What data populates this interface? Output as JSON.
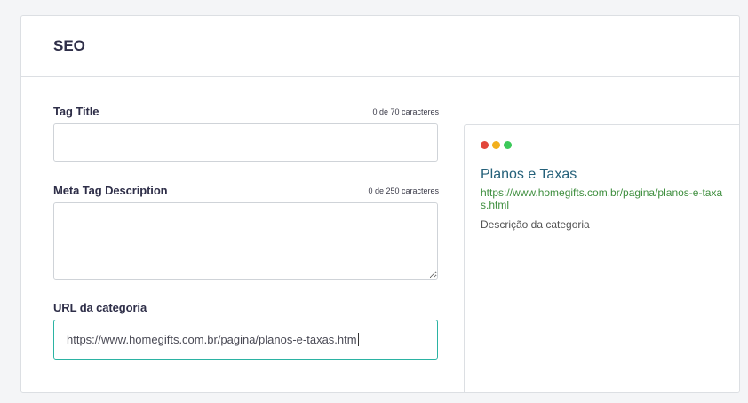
{
  "section": {
    "title": "SEO"
  },
  "fields": {
    "tag_title": {
      "label": "Tag Title",
      "counter": "0 de 70 caracteres",
      "value": ""
    },
    "meta_description": {
      "label": "Meta Tag Description",
      "counter": "0 de 250 caracteres",
      "value": ""
    },
    "category_url": {
      "label": "URL da categoria",
      "value": "https://www.homegifts.com.br/pagina/planos-e-taxas.htm"
    }
  },
  "preview": {
    "window_dots": [
      {
        "name": "red-dot",
        "color": "#e2463b"
      },
      {
        "name": "yellow-dot",
        "color": "#f2b01e"
      },
      {
        "name": "green-dot",
        "color": "#3cc95a"
      }
    ],
    "title": "Planos e Taxas",
    "url": "https://www.homegifts.com.br/pagina/planos-e-taxas.html",
    "description": "Descrição da categoria"
  },
  "colors": {
    "accent": "#2bb3a3",
    "title_link": "#25617a",
    "url_green": "#3f8f3f"
  }
}
